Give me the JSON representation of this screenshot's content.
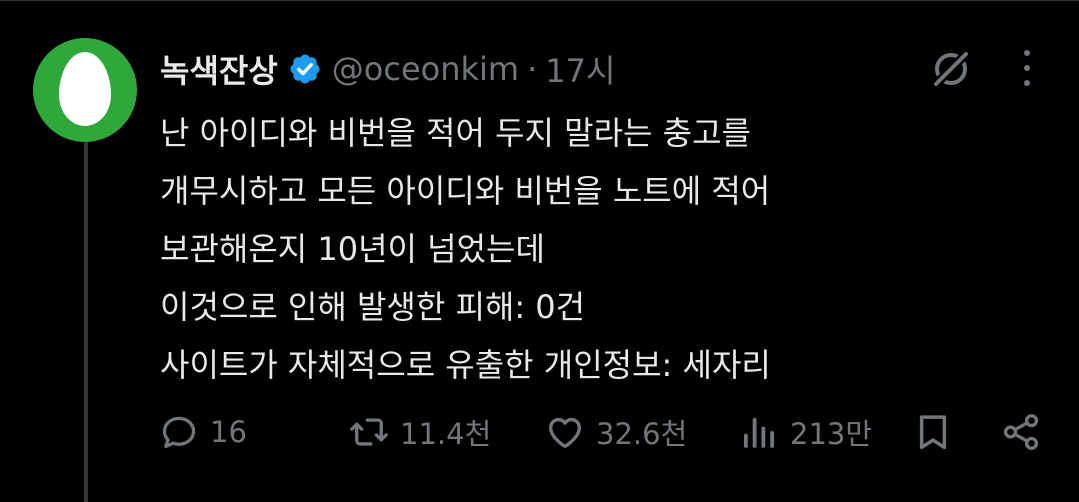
{
  "tweet": {
    "author_name": "녹색잔상",
    "handle": "@oceonkim",
    "separator": "·",
    "time": "17시",
    "lines": [
      "난 아이디와 비번을 적어 두지 말라는 충고를",
      "개무시하고 모든 아이디와 비번을 노트에 적어",
      "보관해온지 10년이 넘었는데",
      "이것으로 인해 발생한 피해: 0건",
      "사이트가 자체적으로 유출한 개인정보: 세자리"
    ]
  },
  "actions": {
    "replies": "16",
    "retweets": "11.4천",
    "likes": "32.6천",
    "views": "213만"
  },
  "icons": {
    "verified": "verified-badge-icon",
    "grok": "grok-icon",
    "more": "more-icon",
    "reply": "reply-icon",
    "retweet": "retweet-icon",
    "like": "heart-icon",
    "views": "views-icon",
    "bookmark": "bookmark-icon",
    "share": "share-icon"
  },
  "colors": {
    "background": "#000000",
    "text": "#e7e9ea",
    "muted": "#71767b",
    "verified": "#1d9bf0",
    "avatar": "#2ea83a"
  }
}
